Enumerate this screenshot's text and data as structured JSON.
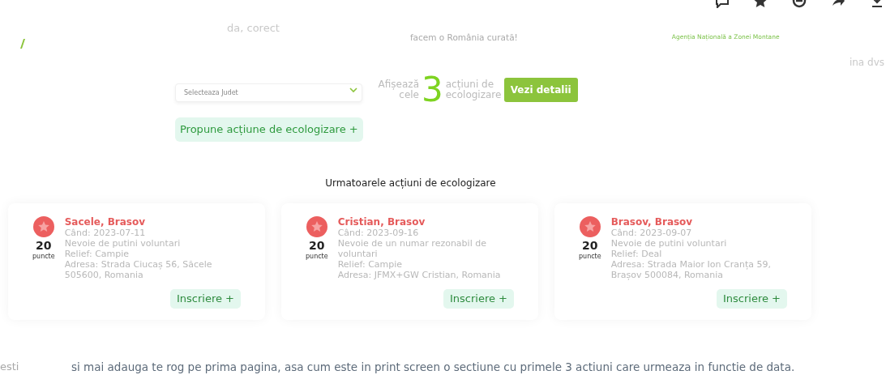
{
  "background_texts": {
    "reply": "da, corect",
    "slogan": "facem o România curată!",
    "agency": "Agenția Națională a Zonei Montane",
    "right_edge": "ina dvs",
    "left_edge": "esti"
  },
  "filter": {
    "placeholder": "Selecteaza Judet",
    "stat_prefix": "Afișează cele",
    "stat_count": "3",
    "stat_suffix": "acțiuni de ecologizare",
    "details_button": "Vezi detalii"
  },
  "propose_button": "Propune acțiune de ecologizare +",
  "section_title": "Urmatoarele acțiuni de ecologizare",
  "actions": [
    {
      "title": "Sacele, Brasov",
      "points": "20",
      "points_label": "puncte",
      "when": "Când: 2023-07-11",
      "need": "Nevoie de putini voluntari",
      "relief": "Relief: Campie",
      "address": "Adresa: Strada Ciucaș 56, Săcele 505600, Romania",
      "button": "Inscriere +"
    },
    {
      "title": "Cristian, Brasov",
      "points": "20",
      "points_label": "puncte",
      "when": "Când: 2023-09-16",
      "need": "Nevoie de un numar rezonabil de voluntari",
      "relief": "Relief: Campie",
      "address": "Adresa: JFMX+GW Cristian, Romania",
      "button": "Inscriere +"
    },
    {
      "title": "Brasov, Brasov",
      "points": "20",
      "points_label": "puncte",
      "when": "Când: 2023-09-07",
      "need": "Nevoie de putini voluntari",
      "relief": "Relief: Deal",
      "address": "Adresa: Strada Maior Ion Cranța 59, Brașov 500084, Romania",
      "button": "Inscriere +"
    }
  ],
  "message": "si mai adauga te rog pe prima pagina, asa cum este in print screen o sectiune cu primele 3 actiuni care urmeaza in functie de data."
}
